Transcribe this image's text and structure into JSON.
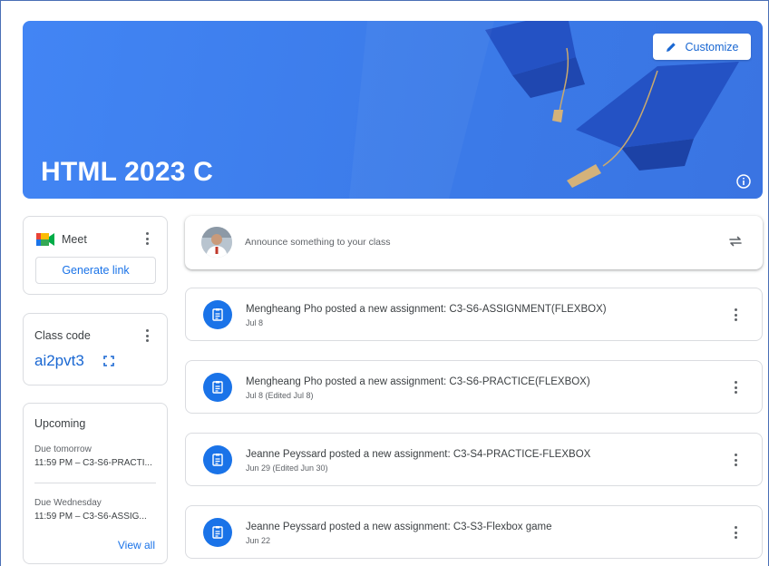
{
  "banner": {
    "class_title": "HTML 2023 C",
    "customize_label": "Customize"
  },
  "meet": {
    "label": "Meet",
    "generate_label": "Generate link"
  },
  "class_code": {
    "label": "Class code",
    "value": "ai2pvt3"
  },
  "upcoming": {
    "title": "Upcoming",
    "items": [
      {
        "due": "Due tomorrow",
        "text": "11:59 PM – C3-S6-PRACTI..."
      },
      {
        "due": "Due Wednesday",
        "text": "11:59 PM – C3-S6-ASSIG..."
      }
    ],
    "view_all_label": "View all"
  },
  "announce": {
    "placeholder": "Announce something to your class"
  },
  "stream": [
    {
      "title": "Mengheang Pho posted a new assignment: C3-S6-ASSIGNMENT(FLEXBOX)",
      "date": "Jul 8"
    },
    {
      "title": "Mengheang Pho posted a new assignment: C3-S6-PRACTICE(FLEXBOX)",
      "date": "Jul 8 (Edited Jul 8)"
    },
    {
      "title": "Jeanne Peyssard posted a new assignment: C3-S4-PRACTICE-FLEXBOX",
      "date": "Jun 29 (Edited Jun 30)"
    },
    {
      "title": "Jeanne Peyssard posted a new assignment: C3-S3-Flexbox game",
      "date": "Jun 22"
    }
  ],
  "icons": {
    "customize": "pencil-icon",
    "info": "info-icon",
    "meet": "google-meet-icon",
    "class_code_expand": "fullscreen-icon",
    "repost": "repost-icon",
    "post": "assignment-icon",
    "more": "more-vert-icon"
  },
  "colors": {
    "banner": "#4285f4",
    "accent": "#1a73e8",
    "code": "#1967d2"
  }
}
